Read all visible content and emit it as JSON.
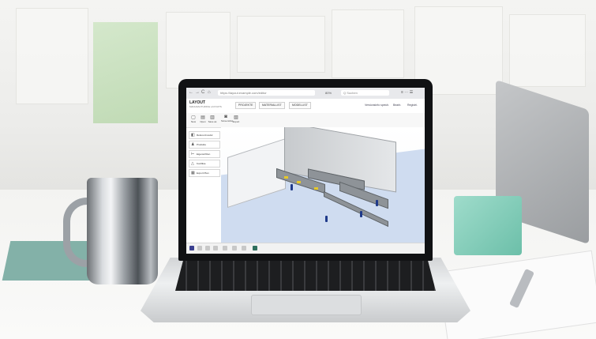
{
  "browser": {
    "url": "https://layout.example.com/editor",
    "zoom": "80%",
    "search_placeholder": "Q Suchen",
    "nav_back": "←",
    "nav_forward": "→",
    "nav_reload": "C",
    "nav_home": "⌂",
    "icons": "≡ ⋯ ☰"
  },
  "app": {
    "logo": "LAYOUT",
    "logo_sub": "MANUFACTURING LAYOUTS",
    "tabs": [
      "PROJEKTE",
      "MATERIALLIST",
      "MODELLIST"
    ],
    "head_links": [
      "Versionsinfo speich.",
      "Bearb.",
      "Registri."
    ]
  },
  "toolbar": {
    "tools": [
      {
        "icon": "file-icon",
        "glyph": "▢",
        "label": "New"
      },
      {
        "icon": "open-icon",
        "glyph": "▤",
        "label": "Open"
      },
      {
        "icon": "save-icon",
        "glyph": "▥",
        "label": "Save as"
      },
      {
        "icon": "screenshot-icon",
        "glyph": "◙",
        "label": "Screenshot"
      },
      {
        "icon": "export-icon",
        "glyph": "▧",
        "label": "Export"
      }
    ]
  },
  "sidebar": {
    "items": [
      {
        "icon": "book-icon",
        "glyph": "◧",
        "label": "Referenzmodul"
      },
      {
        "icon": "person-icon",
        "glyph": "♟",
        "label": "Produkte"
      },
      {
        "icon": "properties-icon",
        "glyph": "⊢",
        "label": "Eigenschften"
      },
      {
        "icon": "warning-icon",
        "glyph": "△",
        "label": "Konflikte"
      },
      {
        "icon": "layout-icon",
        "glyph": "▦",
        "label": "Export Plan"
      }
    ]
  },
  "colors": {
    "floor": "#cfdcf0",
    "workers": "#1f3a8a",
    "highlights": "#e6c829"
  }
}
